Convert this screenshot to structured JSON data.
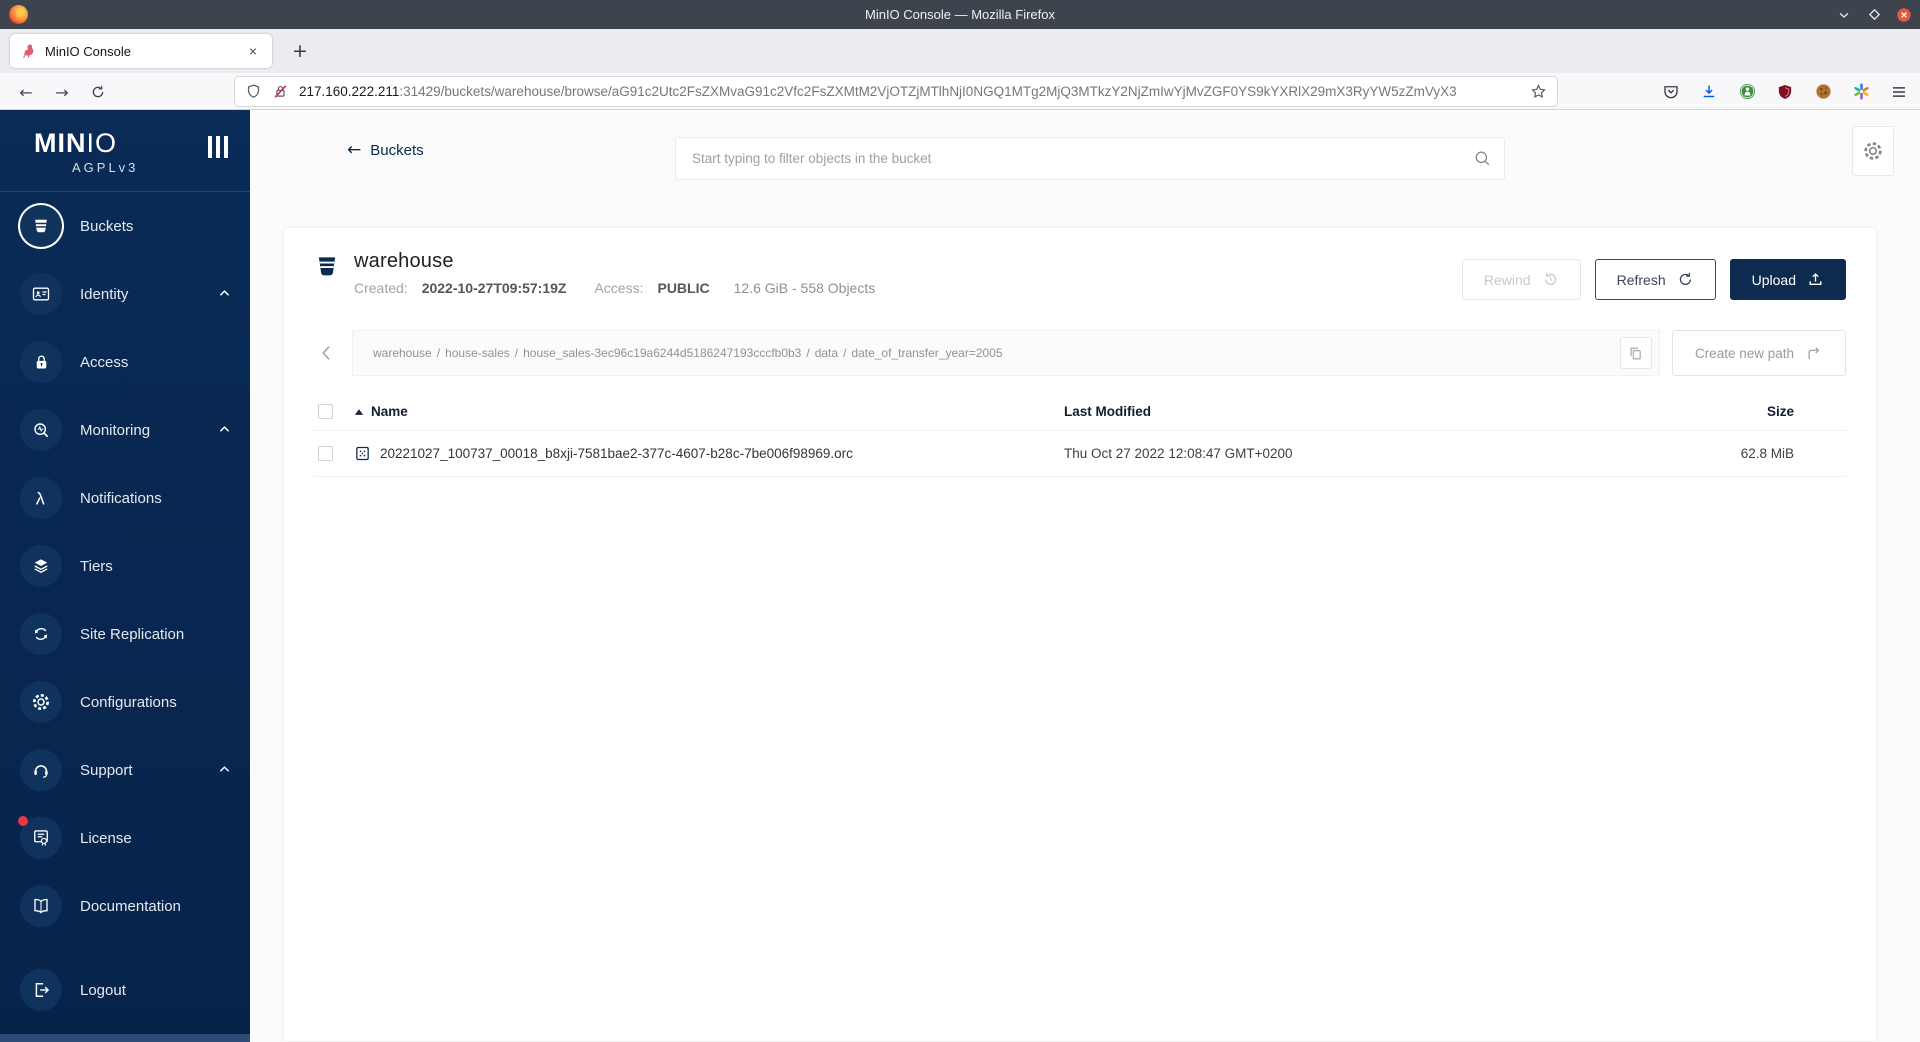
{
  "browser": {
    "window_title": "MinIO Console — Mozilla Firefox",
    "tab_title": "MinIO Console",
    "tab_close": "×",
    "new_tab": "+",
    "back": "←",
    "forward": "→",
    "url_domain": "217.160.222.211",
    "url_path": ":31429/buckets/warehouse/browse/aG91c2Utc2FsZXMvaG91c2Vfc2FsZXMtM2VjOTZjMTlhNjI0NGQ1MTg2MjQ3MTkzY2NjZmIwYjMvZGF0YS9kYXRlX29mX3RyYW5zZmVyX3"
  },
  "sidebar": {
    "logo_bold": "MIN",
    "logo_light": "IO",
    "edition": "AGPLv3",
    "items": [
      {
        "label": "Buckets"
      },
      {
        "label": "Identity"
      },
      {
        "label": "Access"
      },
      {
        "label": "Monitoring"
      },
      {
        "label": "Notifications"
      },
      {
        "label": "Tiers"
      },
      {
        "label": "Site Replication"
      },
      {
        "label": "Configurations"
      },
      {
        "label": "Support"
      },
      {
        "label": "License"
      },
      {
        "label": "Documentation"
      },
      {
        "label": "Logout"
      }
    ]
  },
  "header": {
    "back_label": "Buckets",
    "search_placeholder": "Start typing to filter objects in the bucket"
  },
  "bucket": {
    "name": "warehouse",
    "created_label": "Created:",
    "created_value": "2022-10-27T09:57:19Z",
    "access_label": "Access:",
    "access_value": "PUBLIC",
    "usage": "12.6 GiB - 558 Objects",
    "rewind_label": "Rewind",
    "refresh_label": "Refresh",
    "upload_label": "Upload"
  },
  "browse": {
    "separator": "/",
    "path_parts": [
      "warehouse",
      "house-sales",
      "house_sales-3ec96c19a6244d5186247193cccfb0b3",
      "data",
      "date_of_transfer_year=2005"
    ],
    "create_path_label": "Create new path"
  },
  "table": {
    "col_name": "Name",
    "col_modified": "Last Modified",
    "col_size": "Size",
    "rows": [
      {
        "name": "20221027_100737_00018_b8xji-7581bae2-377c-4607-b28c-7be006f98969.orc",
        "modified": "Thu Oct 27 2022 12:08:47 GMT+0200",
        "size": "62.8 MiB"
      }
    ]
  },
  "colors": {
    "sidebar_navy": "#07234A",
    "accent_navy": "#0C2B4E",
    "download_blue": "#0060DF",
    "license_badge": "#E8374A",
    "insecure_red": "#D7264C"
  }
}
